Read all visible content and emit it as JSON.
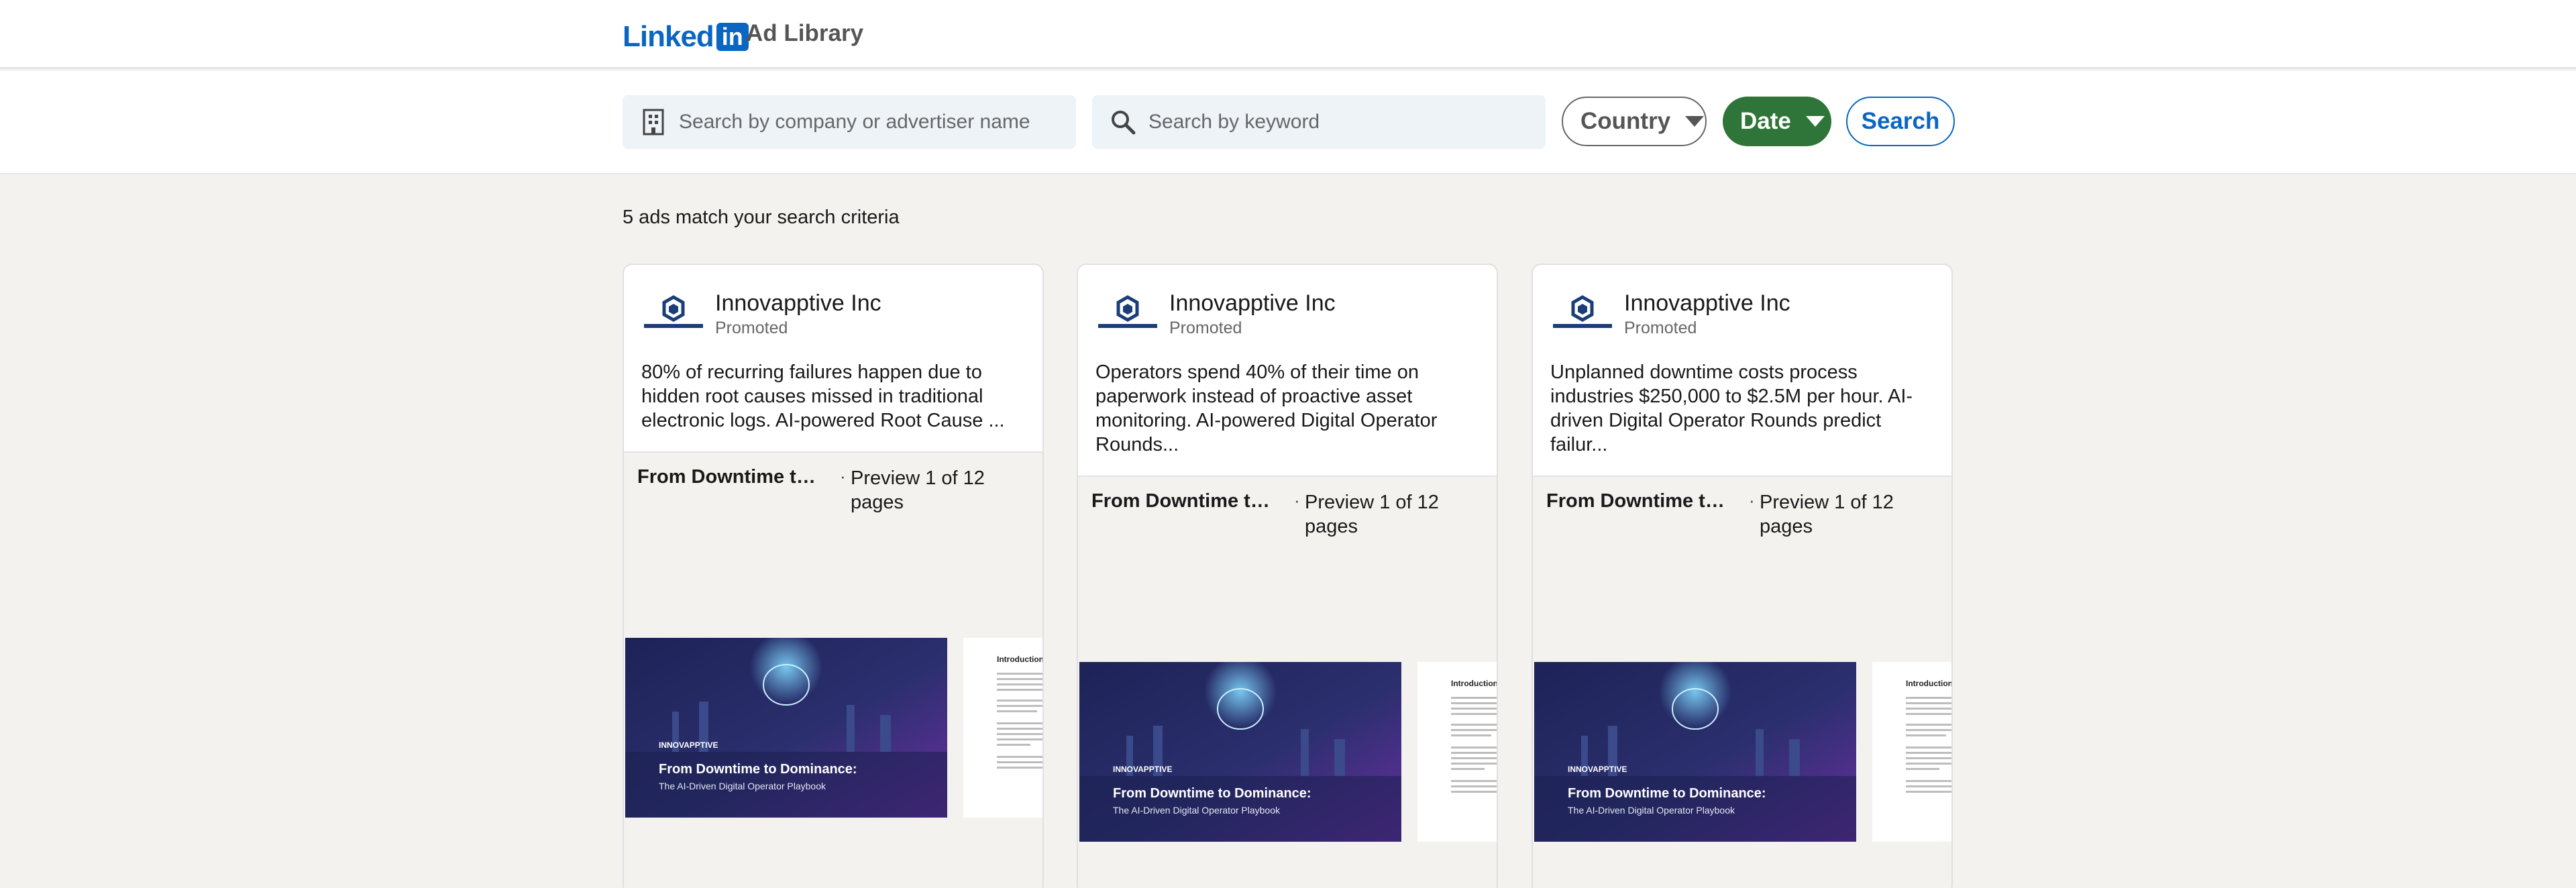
{
  "header": {
    "logo_text": "Linked",
    "logo_box": "in",
    "product": "Ad Library"
  },
  "search": {
    "company_placeholder": "Search by company or advertiser name",
    "keyword_placeholder": "Search by keyword",
    "country_label": "Country",
    "date_label": "Date",
    "search_label": "Search"
  },
  "results": {
    "count_text": "5 ads match your search criteria"
  },
  "colors": {
    "linkedin_blue": "#0a66c2",
    "date_green": "#2f7438",
    "page_bg": "#f3f2ef"
  },
  "cards": [
    {
      "brand": "Innovapptive Inc",
      "status": "Promoted",
      "text": "80% of recurring failures happen due to hidden root causes missed in traditional electronic logs. AI-powered Root Cause ...",
      "doc_title": "From Downtime to ...",
      "preview": "Preview 1 of 12 pages",
      "cover_brand": "INNOVAPPTIVE",
      "cover_title": "From Downtime to Dominance:",
      "cover_subtitle": "The AI-Driven Digital Operator Playbook",
      "page2_heading": "Introduction"
    },
    {
      "brand": "Innovapptive Inc",
      "status": "Promoted",
      "text": "Operators spend 40% of their time on paperwork instead of proactive asset monitoring. AI-powered Digital Operator Rounds...",
      "doc_title": "From Downtime to ...",
      "preview": "Preview 1 of 12 pages",
      "cover_brand": "INNOVAPPTIVE",
      "cover_title": "From Downtime to Dominance:",
      "cover_subtitle": "The AI-Driven Digital Operator Playbook",
      "page2_heading": "Introduction"
    },
    {
      "brand": "Innovapptive Inc",
      "status": "Promoted",
      "text": "Unplanned downtime costs process industries $250,000 to $2.5M per hour. AI-driven Digital Operator Rounds predict failur...",
      "doc_title": "From Downtime to ...",
      "preview": "Preview 1 of 12 pages",
      "cover_brand": "INNOVAPPTIVE",
      "cover_title": "From Downtime to Dominance:",
      "cover_subtitle": "The AI-Driven Digital Operator Playbook",
      "page2_heading": "Introduction"
    }
  ]
}
